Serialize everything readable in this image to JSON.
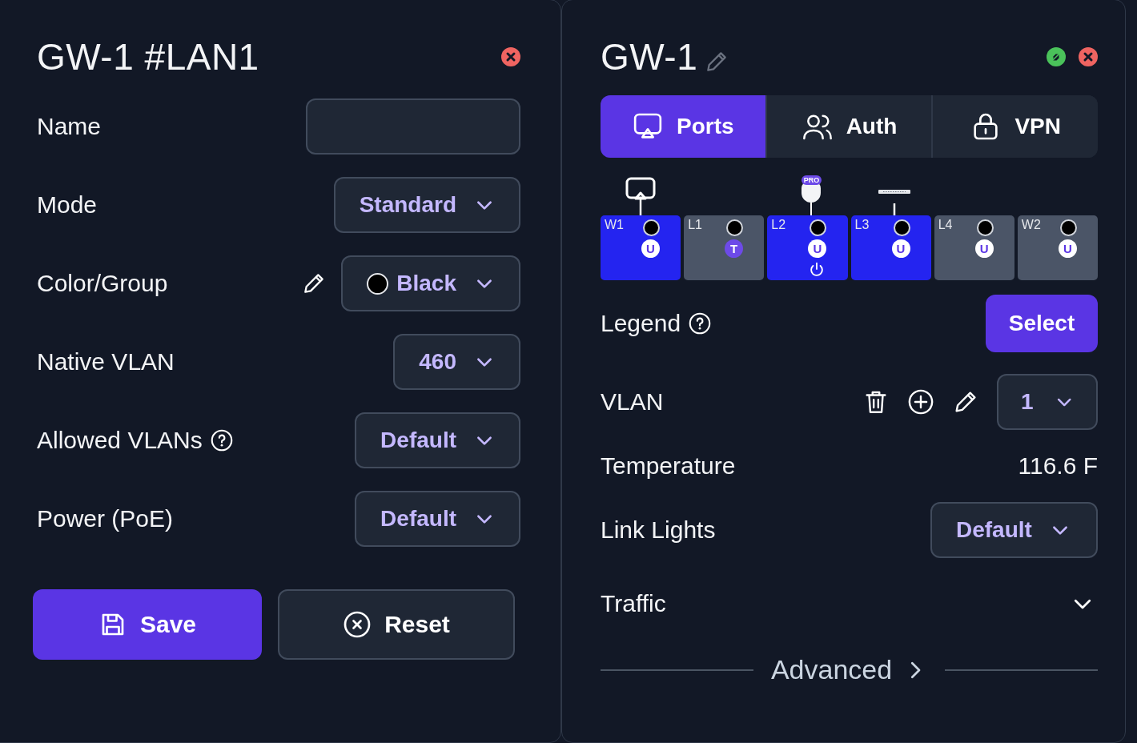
{
  "port_panel": {
    "title": "GW-1 #LAN1",
    "rows": [
      {
        "kind": "text",
        "label": "Name"
      },
      {
        "kind": "select",
        "label": "Mode",
        "value": "Standard"
      },
      {
        "kind": "color-select",
        "label": "Color/Group",
        "value": "Black",
        "color": "#000000"
      },
      {
        "kind": "select",
        "label": "Native VLAN",
        "value": "460"
      },
      {
        "kind": "select",
        "label": "Allowed VLANs",
        "value": "Default",
        "help": true
      },
      {
        "kind": "select",
        "label": "Power (PoE)",
        "value": "Default"
      },
      {
        "kind": "partial"
      }
    ],
    "buttons": [
      {
        "label": "Save",
        "kind": "primary"
      },
      {
        "label": "Reset",
        "kind": "secondary"
      }
    ]
  },
  "device_panel": {
    "title": "GW-1",
    "tabs": [
      {
        "label": "Ports",
        "selected": true
      },
      {
        "label": "Auth",
        "selected": false
      },
      {
        "label": "VPN",
        "selected": false
      }
    ],
    "ports": [
      {
        "label": "W1",
        "selected": true,
        "vlan": {
          "text": "U",
          "kind": "untagged"
        },
        "poe": false,
        "device": {
          "kind": "display"
        }
      },
      {
        "label": "L1",
        "selected": false,
        "vlan": {
          "text": "T",
          "kind": "tagged"
        },
        "poe": false
      },
      {
        "label": "L2",
        "selected": true,
        "vlan": {
          "text": "U",
          "kind": "untagged"
        },
        "poe": true,
        "device": {
          "kind": "access-point",
          "tag": "PRO"
        }
      },
      {
        "label": "L3",
        "selected": true,
        "vlan": {
          "text": "U",
          "kind": "untagged"
        },
        "poe": false,
        "device": {
          "kind": "switch"
        }
      },
      {
        "label": "L4",
        "selected": false,
        "vlan": {
          "text": "U",
          "kind": "untagged"
        },
        "poe": false
      },
      {
        "label": "W2",
        "selected": false,
        "vlan": {
          "text": "U",
          "kind": "untagged"
        },
        "poe": false
      }
    ],
    "legend": {
      "label": "Legend",
      "button": "Select"
    },
    "vlan": {
      "label": "VLAN",
      "value": "1"
    },
    "temperature": {
      "label": "Temperature",
      "value": "116.6 F"
    },
    "link_lights": {
      "label": "Link Lights",
      "value": "Default"
    },
    "traffic": {
      "label": "Traffic",
      "expanded": false
    },
    "advanced": {
      "label": "Advanced"
    }
  }
}
